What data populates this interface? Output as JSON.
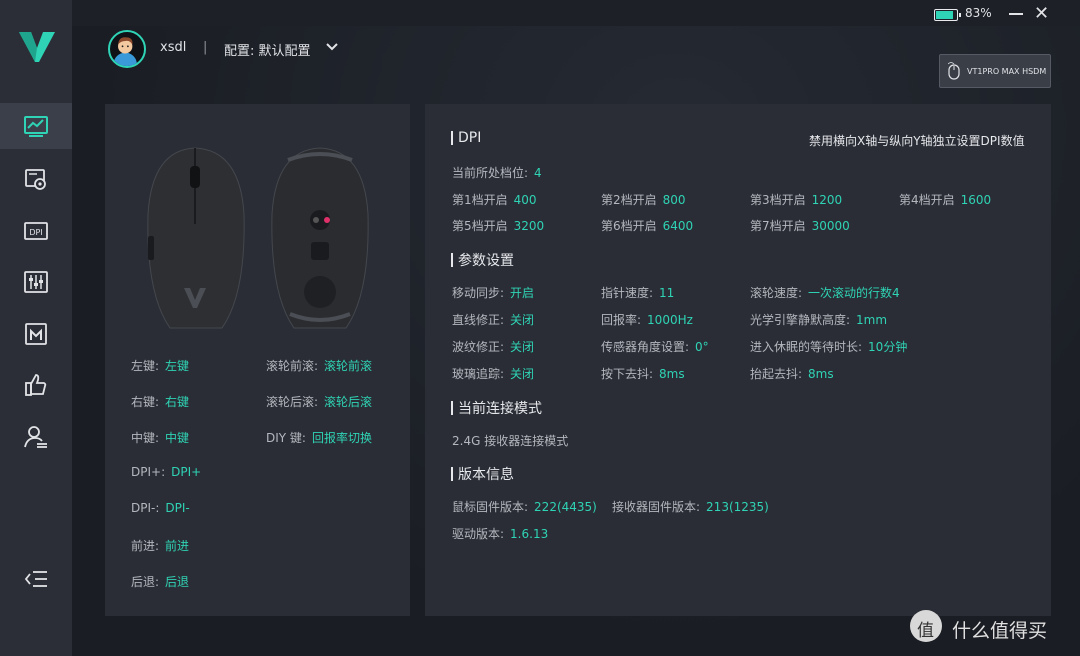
{
  "topbar": {
    "battery_percent": 83,
    "battery_label": "83%",
    "close_glyph": "✕"
  },
  "user": {
    "name": "xsdl",
    "separator": "|",
    "profile_label": "配置: 默认配置"
  },
  "device": {
    "label": "VT1PRO MAX HSDM"
  },
  "sidebar": {
    "items": [
      {
        "name": "performance-icon",
        "active": true
      },
      {
        "name": "settings-icon",
        "active": false
      },
      {
        "name": "dpi-icon",
        "active": false
      },
      {
        "name": "equalizer-icon",
        "active": false
      },
      {
        "name": "macro-icon",
        "active": false
      },
      {
        "name": "thumbs-up-icon",
        "active": false
      },
      {
        "name": "user-settings-icon",
        "active": false
      }
    ],
    "collapse_icon": "collapse-menu-icon"
  },
  "keys": {
    "left": {
      "k": "左键:",
      "v": "左键"
    },
    "right": {
      "k": "右键:",
      "v": "右键"
    },
    "middle": {
      "k": "中键:",
      "v": "中键"
    },
    "dpi_up": {
      "k": "DPI+:",
      "v": "DPI+"
    },
    "dpi_down": {
      "k": "DPI-:",
      "v": "DPI-"
    },
    "forward": {
      "k": "前进:",
      "v": "前进"
    },
    "back": {
      "k": "后退:",
      "v": "后退"
    },
    "wheel_fwd": {
      "k": "滚轮前滚:",
      "v": "滚轮前滚"
    },
    "wheel_back": {
      "k": "滚轮后滚:",
      "v": "滚轮后滚"
    },
    "diy": {
      "k": "DIY 键:",
      "v": "回报率切换"
    }
  },
  "dpi": {
    "title": "DPI",
    "note": "禁用横向X轴与纵向Y轴独立设置DPI数值",
    "current": {
      "k": "当前所处档位:",
      "v": "4"
    },
    "levels": [
      {
        "k": "第1档开启",
        "v": "400"
      },
      {
        "k": "第2档开启",
        "v": "800"
      },
      {
        "k": "第3档开启",
        "v": "1200"
      },
      {
        "k": "第4档开启",
        "v": "1600"
      },
      {
        "k": "第5档开启",
        "v": "3200"
      },
      {
        "k": "第6档开启",
        "v": "6400"
      },
      {
        "k": "第7档开启",
        "v": "30000"
      }
    ]
  },
  "params": {
    "title": "参数设置",
    "items": [
      {
        "k": "移动同步:",
        "v": "开启"
      },
      {
        "k": "指针速度:",
        "v": "11"
      },
      {
        "k": "滚轮速度:",
        "v": "一次滚动的行数4"
      },
      {
        "k": "直线修正:",
        "v": "关闭"
      },
      {
        "k": "回报率:",
        "v": "1000Hz"
      },
      {
        "k": "光学引擎静默高度:",
        "v": "1mm"
      },
      {
        "k": "波纹修正:",
        "v": "关闭"
      },
      {
        "k": "传感器角度设置:",
        "v": "0°"
      },
      {
        "k": "进入休眠的等待时长:",
        "v": "10分钟"
      },
      {
        "k": "玻璃追踪:",
        "v": "关闭"
      },
      {
        "k": "按下去抖:",
        "v": "8ms"
      },
      {
        "k": "抬起去抖:",
        "v": "8ms"
      }
    ]
  },
  "connection": {
    "title": "当前连接模式",
    "value": "2.4G 接收器连接模式"
  },
  "version": {
    "title": "版本信息",
    "mouse_fw": {
      "k": "鼠标固件版本:",
      "v": "222(4435)"
    },
    "receiver_fw": {
      "k": "接收器固件版本:",
      "v": "213(1235)"
    },
    "driver": {
      "k": "驱动版本:",
      "v": "1.6.13"
    }
  },
  "watermark": {
    "text": "什么值得买",
    "glyph": "值"
  },
  "colors": {
    "accent": "#2fd3b5",
    "panel": "#2a2d35",
    "sidebar": "#2b2e36"
  }
}
